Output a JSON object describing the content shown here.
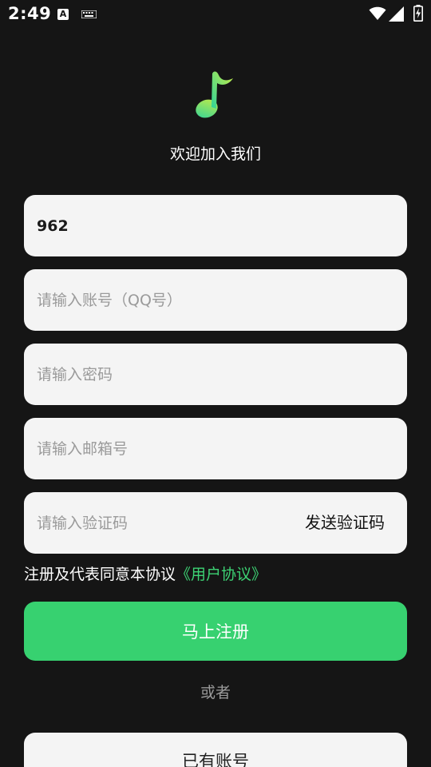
{
  "status_bar": {
    "time": "2:49",
    "icons": [
      "a-icon",
      "keyboard-icon",
      "wifi-icon",
      "cellular-signal-icon",
      "battery-charging-icon"
    ]
  },
  "header": {
    "logo_icon": "music-note-icon",
    "title": "欢迎加入我们"
  },
  "form": {
    "field1": {
      "value": "962",
      "placeholder": ""
    },
    "account": {
      "value": "",
      "placeholder": "请输入账号（QQ号）"
    },
    "password": {
      "value": "",
      "placeholder": "请输入密码"
    },
    "email": {
      "value": "",
      "placeholder": "请输入邮箱号"
    },
    "code": {
      "value": "",
      "placeholder": "请输入验证码"
    },
    "send_code_label": "发送验证码"
  },
  "agreement": {
    "text": "注册及代表同意本协议",
    "link": "《用户协议》"
  },
  "actions": {
    "register_label": "马上注册",
    "or_text": "或者",
    "login_label": "已有账号"
  },
  "colors": {
    "background": "#151515",
    "accent": "#37d170",
    "link": "#3dd374",
    "field_bg": "#f4f4f4"
  }
}
